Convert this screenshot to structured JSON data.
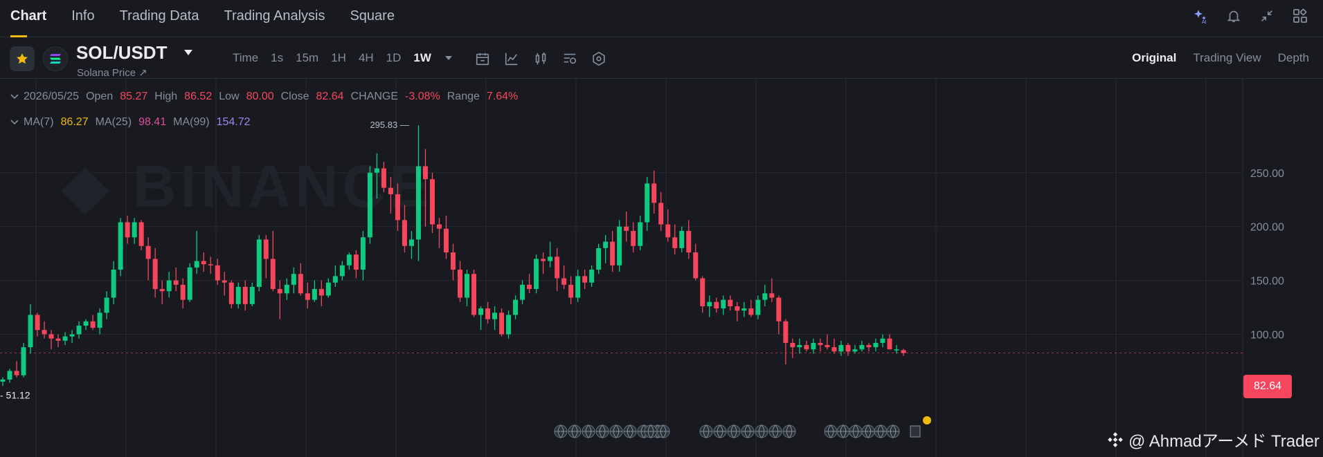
{
  "nav": {
    "tabs": [
      "Chart",
      "Info",
      "Trading Data",
      "Trading Analysis",
      "Square"
    ],
    "active": 0
  },
  "toolbar": {
    "pair": "SOL/USDT",
    "subtitle": "Solana Price ↗",
    "intervals": [
      "Time",
      "1s",
      "15m",
      "1H",
      "4H",
      "1D",
      "1W"
    ],
    "active_interval": 6,
    "views": [
      "Original",
      "Trading View",
      "Depth"
    ],
    "active_view": 0
  },
  "ohlc": {
    "date": "2026/05/25",
    "open_label": "Open",
    "open": "85.27",
    "high_label": "High",
    "high": "86.52",
    "low_label": "Low",
    "low": "80.00",
    "close_label": "Close",
    "close": "82.64",
    "change_label": "CHANGE",
    "change": "-3.08%",
    "range_label": "Range",
    "range": "7.64%"
  },
  "ma": {
    "ma7_label": "MA(7)",
    "ma7": "86.27",
    "ma25_label": "MA(25)",
    "ma25": "98.41",
    "ma99_label": "MA(99)",
    "ma99": "154.72"
  },
  "last_price": "82.64",
  "watermark": "@ Ahmadアーメド Trader",
  "colors": {
    "up": "#0ecb81",
    "down": "#f6465d",
    "bg": "#181a20",
    "grid": "#262a30",
    "accent": "#f0b90b"
  },
  "chart_data": {
    "type": "candlestick",
    "y_ticks": [
      100,
      150,
      200,
      250
    ],
    "y_range": [
      40,
      300
    ],
    "annotations": {
      "high": "295.83",
      "low": "51.12"
    },
    "candles": [
      [
        56,
        60,
        52,
        58
      ],
      [
        58,
        68,
        55,
        66
      ],
      [
        66,
        75,
        60,
        62
      ],
      [
        62,
        92,
        60,
        88
      ],
      [
        88,
        128,
        82,
        118
      ],
      [
        118,
        120,
        98,
        104
      ],
      [
        104,
        112,
        96,
        100
      ],
      [
        100,
        104,
        86,
        96
      ],
      [
        96,
        100,
        88,
        94
      ],
      [
        94,
        102,
        90,
        98
      ],
      [
        98,
        104,
        92,
        100
      ],
      [
        100,
        112,
        96,
        108
      ],
      [
        108,
        114,
        104,
        112
      ],
      [
        112,
        118,
        104,
        106
      ],
      [
        106,
        124,
        100,
        120
      ],
      [
        120,
        140,
        114,
        134
      ],
      [
        134,
        168,
        128,
        160
      ],
      [
        160,
        208,
        154,
        204
      ],
      [
        204,
        210,
        184,
        190
      ],
      [
        190,
        208,
        184,
        204
      ],
      [
        204,
        206,
        178,
        182
      ],
      [
        182,
        190,
        150,
        170
      ],
      [
        170,
        180,
        134,
        142
      ],
      [
        142,
        150,
        128,
        140
      ],
      [
        140,
        158,
        134,
        150
      ],
      [
        150,
        162,
        140,
        146
      ],
      [
        146,
        152,
        124,
        132
      ],
      [
        132,
        166,
        130,
        162
      ],
      [
        162,
        196,
        156,
        168
      ],
      [
        168,
        176,
        158,
        165
      ],
      [
        165,
        172,
        156,
        164
      ],
      [
        164,
        170,
        146,
        150
      ],
      [
        150,
        158,
        136,
        148
      ],
      [
        148,
        150,
        124,
        128
      ],
      [
        128,
        148,
        124,
        144
      ],
      [
        144,
        150,
        122,
        128
      ],
      [
        128,
        148,
        126,
        144
      ],
      [
        144,
        192,
        140,
        188
      ],
      [
        188,
        192,
        152,
        170
      ],
      [
        170,
        196,
        140,
        142
      ],
      [
        142,
        150,
        114,
        138
      ],
      [
        138,
        152,
        132,
        146
      ],
      [
        146,
        162,
        138,
        156
      ],
      [
        156,
        166,
        136,
        138
      ],
      [
        138,
        148,
        124,
        132
      ],
      [
        132,
        150,
        130,
        142
      ],
      [
        142,
        150,
        126,
        136
      ],
      [
        136,
        152,
        134,
        148
      ],
      [
        148,
        164,
        144,
        154
      ],
      [
        154,
        168,
        150,
        164
      ],
      [
        164,
        176,
        160,
        174
      ],
      [
        174,
        178,
        152,
        160
      ],
      [
        160,
        196,
        150,
        190
      ],
      [
        190,
        256,
        184,
        250
      ],
      [
        250,
        268,
        226,
        254
      ],
      [
        254,
        260,
        232,
        236
      ],
      [
        236,
        246,
        212,
        230
      ],
      [
        230,
        240,
        196,
        206
      ],
      [
        206,
        220,
        176,
        182
      ],
      [
        182,
        196,
        170,
        188
      ],
      [
        188,
        294,
        168,
        256
      ],
      [
        256,
        272,
        200,
        244
      ],
      [
        244,
        250,
        194,
        202
      ],
      [
        202,
        208,
        180,
        198
      ],
      [
        198,
        210,
        170,
        176
      ],
      [
        176,
        184,
        150,
        160
      ],
      [
        160,
        168,
        130,
        134
      ],
      [
        134,
        160,
        126,
        156
      ],
      [
        156,
        160,
        116,
        118
      ],
      [
        118,
        126,
        104,
        124
      ],
      [
        124,
        130,
        110,
        114
      ],
      [
        114,
        126,
        104,
        120
      ],
      [
        120,
        124,
        98,
        100
      ],
      [
        100,
        122,
        96,
        118
      ],
      [
        118,
        136,
        114,
        132
      ],
      [
        132,
        150,
        128,
        146
      ],
      [
        146,
        156,
        138,
        142
      ],
      [
        142,
        174,
        138,
        170
      ],
      [
        170,
        176,
        156,
        168
      ],
      [
        168,
        186,
        162,
        172
      ],
      [
        172,
        180,
        140,
        152
      ],
      [
        152,
        164,
        142,
        146
      ],
      [
        146,
        154,
        128,
        134
      ],
      [
        134,
        160,
        130,
        154
      ],
      [
        154,
        160,
        142,
        148
      ],
      [
        148,
        164,
        144,
        160
      ],
      [
        160,
        184,
        156,
        180
      ],
      [
        180,
        192,
        166,
        186
      ],
      [
        186,
        196,
        158,
        164
      ],
      [
        164,
        206,
        158,
        200
      ],
      [
        200,
        214,
        186,
        196
      ],
      [
        196,
        204,
        176,
        182
      ],
      [
        182,
        210,
        178,
        204
      ],
      [
        204,
        246,
        196,
        240
      ],
      [
        240,
        252,
        212,
        222
      ],
      [
        222,
        232,
        196,
        202
      ],
      [
        202,
        216,
        186,
        190
      ],
      [
        190,
        202,
        174,
        180
      ],
      [
        180,
        200,
        176,
        196
      ],
      [
        196,
        206,
        170,
        176
      ],
      [
        176,
        184,
        150,
        152
      ],
      [
        152,
        154,
        120,
        126
      ],
      [
        126,
        136,
        116,
        130
      ],
      [
        130,
        134,
        120,
        124
      ],
      [
        124,
        136,
        118,
        132
      ],
      [
        132,
        136,
        122,
        126
      ],
      [
        126,
        130,
        112,
        122
      ],
      [
        122,
        130,
        116,
        124
      ],
      [
        124,
        132,
        116,
        118
      ],
      [
        118,
        136,
        114,
        132
      ],
      [
        132,
        146,
        126,
        138
      ],
      [
        138,
        152,
        130,
        134
      ],
      [
        134,
        136,
        100,
        112
      ],
      [
        112,
        114,
        72,
        92
      ],
      [
        92,
        96,
        78,
        88
      ],
      [
        88,
        96,
        82,
        90
      ],
      [
        90,
        94,
        84,
        86
      ],
      [
        86,
        96,
        82,
        92
      ],
      [
        92,
        96,
        84,
        90
      ],
      [
        90,
        100,
        86,
        88
      ],
      [
        88,
        96,
        82,
        84
      ],
      [
        84,
        94,
        80,
        90
      ],
      [
        90,
        92,
        80,
        84
      ],
      [
        84,
        90,
        82,
        86
      ],
      [
        86,
        94,
        84,
        90
      ],
      [
        90,
        92,
        84,
        88
      ],
      [
        88,
        96,
        84,
        92
      ],
      [
        92,
        100,
        88,
        96
      ],
      [
        96,
        100,
        86,
        86
      ],
      [
        86,
        90,
        82,
        86
      ],
      [
        85.27,
        86.52,
        80,
        82.64
      ]
    ]
  }
}
